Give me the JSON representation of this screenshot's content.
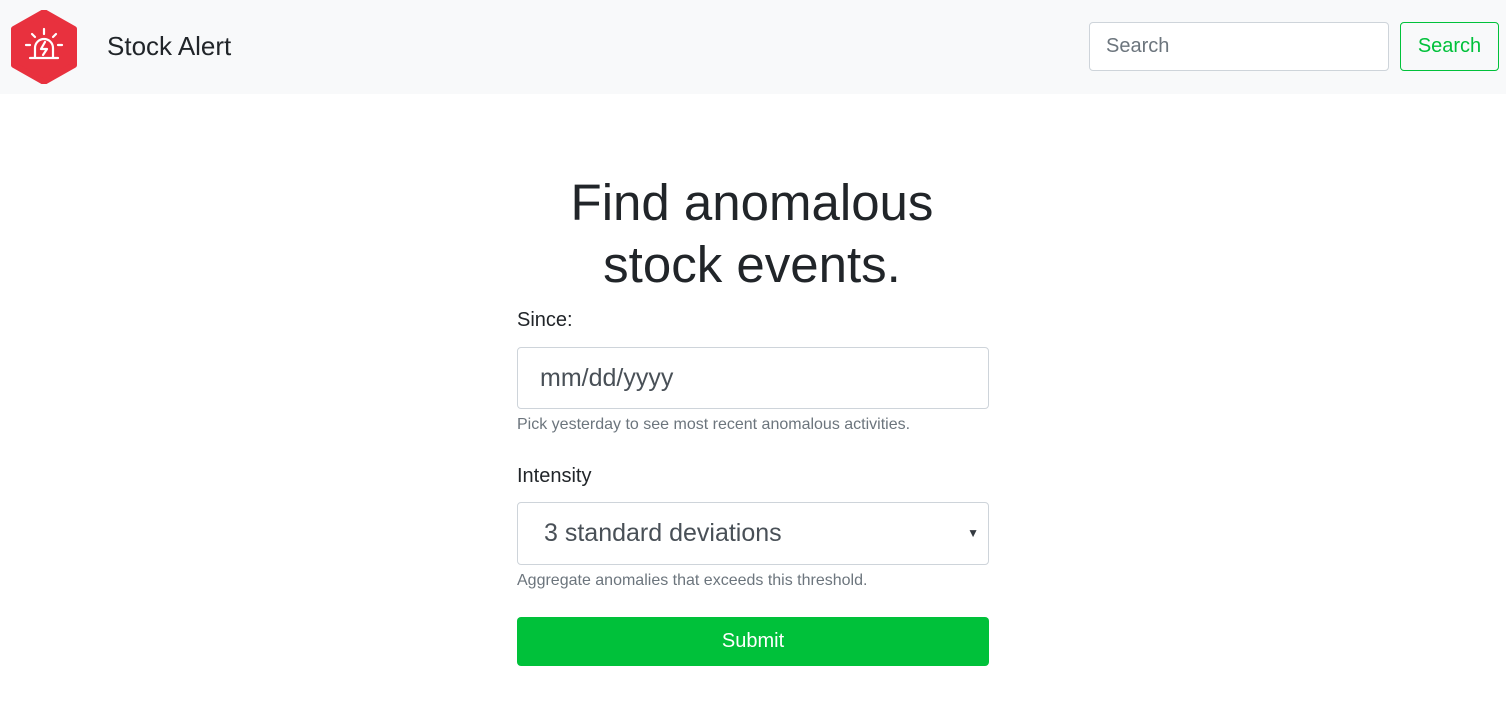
{
  "navbar": {
    "brand": "Stock Alert",
    "logo_icon": "alarm-siren-icon",
    "search_placeholder": "Search",
    "search_button": "Search"
  },
  "colors": {
    "accent": "#00c13a",
    "logo": "#e8313e",
    "navbar_bg": "#f8f9fa"
  },
  "main": {
    "title": "Find anomalous stock events.",
    "since": {
      "label": "Since:",
      "placeholder": "mm/dd/yyyy",
      "help": "Pick yesterday to see most recent anomalous activities."
    },
    "intensity": {
      "label": "Intensity",
      "selected": "3 standard deviations",
      "caret_icon": "caret-down-icon",
      "help": "Aggregate anomalies that exceeds this threshold."
    },
    "submit": "Submit"
  }
}
